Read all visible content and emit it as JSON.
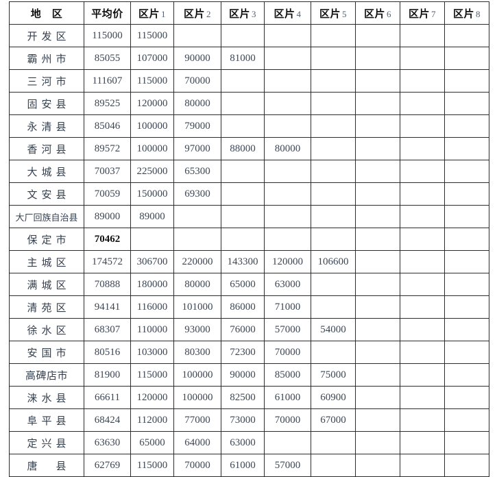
{
  "table": {
    "headers": [
      {
        "label": "地　区",
        "index": ""
      },
      {
        "label": "平均价",
        "index": ""
      },
      {
        "label": "区片",
        "index": "1"
      },
      {
        "label": "区片",
        "index": "2"
      },
      {
        "label": "区片",
        "index": "3"
      },
      {
        "label": "区片",
        "index": "4"
      },
      {
        "label": "区片",
        "index": "5"
      },
      {
        "label": "区片",
        "index": "6"
      },
      {
        "label": "区片",
        "index": "7"
      },
      {
        "label": "区片",
        "index": "8"
      }
    ],
    "rows": [
      {
        "region": "开发区",
        "style": "spaced",
        "avg": "115000",
        "avg_bold": false,
        "zones": [
          "115000",
          "",
          "",
          "",
          "",
          "",
          "",
          ""
        ]
      },
      {
        "region": "霸州市",
        "style": "spaced",
        "avg": "85055",
        "avg_bold": false,
        "zones": [
          "107000",
          "90000",
          "81000",
          "",
          "",
          "",
          "",
          ""
        ]
      },
      {
        "region": "三河市",
        "style": "spaced",
        "avg": "111607",
        "avg_bold": false,
        "zones": [
          "115000",
          "70000",
          "",
          "",
          "",
          "",
          "",
          ""
        ]
      },
      {
        "region": "固安县",
        "style": "spaced",
        "avg": "89525",
        "avg_bold": false,
        "zones": [
          "120000",
          "80000",
          "",
          "",
          "",
          "",
          "",
          ""
        ]
      },
      {
        "region": "永清县",
        "style": "spaced",
        "avg": "85046",
        "avg_bold": false,
        "zones": [
          "100000",
          "79000",
          "",
          "",
          "",
          "",
          "",
          ""
        ]
      },
      {
        "region": "香河县",
        "style": "spaced",
        "avg": "89572",
        "avg_bold": false,
        "zones": [
          "100000",
          "97000",
          "88000",
          "80000",
          "",
          "",
          "",
          ""
        ]
      },
      {
        "region": "大城县",
        "style": "spaced",
        "avg": "70037",
        "avg_bold": false,
        "zones": [
          "225000",
          "65300",
          "",
          "",
          "",
          "",
          "",
          ""
        ]
      },
      {
        "region": "文安县",
        "style": "spaced",
        "avg": "70059",
        "avg_bold": false,
        "zones": [
          "150000",
          "69300",
          "",
          "",
          "",
          "",
          "",
          ""
        ]
      },
      {
        "region": "大厂回族自治县",
        "style": "narrow",
        "avg": "89000",
        "avg_bold": false,
        "zones": [
          "89000",
          "",
          "",
          "",
          "",
          "",
          "",
          ""
        ]
      },
      {
        "region": "保定市",
        "style": "spaced",
        "avg": "70462",
        "avg_bold": true,
        "zones": [
          "",
          "",
          "",
          "",
          "",
          "",
          "",
          ""
        ]
      },
      {
        "region": "主城区",
        "style": "spaced",
        "avg": "174572",
        "avg_bold": false,
        "zones": [
          "306700",
          "220000",
          "143300",
          "120000",
          "106600",
          "",
          "",
          ""
        ]
      },
      {
        "region": "满城区",
        "style": "spaced",
        "avg": "70888",
        "avg_bold": false,
        "zones": [
          "180000",
          "80000",
          "65000",
          "63000",
          "",
          "",
          "",
          ""
        ]
      },
      {
        "region": "清苑区",
        "style": "spaced",
        "avg": "94141",
        "avg_bold": false,
        "zones": [
          "116000",
          "101000",
          "86000",
          "71000",
          "",
          "",
          "",
          ""
        ]
      },
      {
        "region": "徐水区",
        "style": "spaced",
        "avg": "68307",
        "avg_bold": false,
        "zones": [
          "110000",
          "93000",
          "76000",
          "57000",
          "54000",
          "",
          "",
          ""
        ]
      },
      {
        "region": "安国市",
        "style": "spaced",
        "avg": "80516",
        "avg_bold": false,
        "zones": [
          "103000",
          "80300",
          "72300",
          "70000",
          "",
          "",
          "",
          ""
        ]
      },
      {
        "region": "高碑店市",
        "style": "normal",
        "avg": "81900",
        "avg_bold": false,
        "zones": [
          "115000",
          "100000",
          "90000",
          "85000",
          "75000",
          "",
          "",
          ""
        ]
      },
      {
        "region": "涞水县",
        "style": "spaced",
        "avg": "66611",
        "avg_bold": false,
        "zones": [
          "120000",
          "100000",
          "82500",
          "61000",
          "60900",
          "",
          "",
          ""
        ]
      },
      {
        "region": "阜平县",
        "style": "spaced",
        "avg": "68424",
        "avg_bold": false,
        "zones": [
          "112000",
          "77000",
          "73000",
          "70000",
          "67000",
          "",
          "",
          ""
        ]
      },
      {
        "region": "定兴县",
        "style": "spaced",
        "avg": "63630",
        "avg_bold": false,
        "zones": [
          "65000",
          "64000",
          "63000",
          "",
          "",
          "",
          "",
          ""
        ]
      },
      {
        "region": "唐　县",
        "style": "spaced",
        "avg": "62769",
        "avg_bold": false,
        "zones": [
          "115000",
          "70000",
          "61000",
          "57000",
          "",
          "",
          "",
          ""
        ]
      }
    ]
  }
}
